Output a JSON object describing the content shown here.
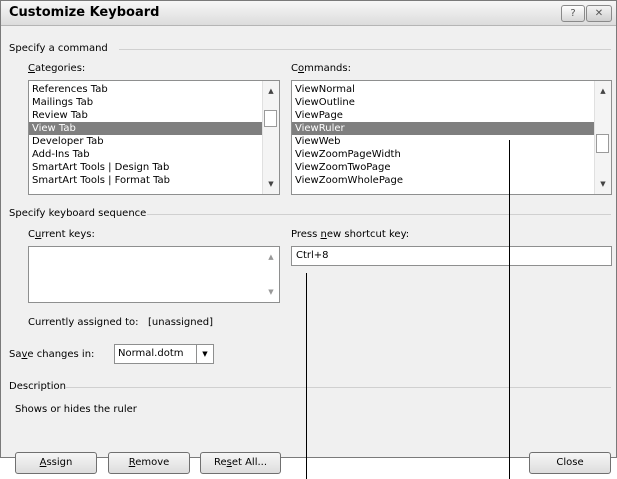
{
  "window": {
    "title": "Customize Keyboard",
    "help_glyph": "?",
    "close_glyph": "✕"
  },
  "command_group": {
    "label": "Specify a command",
    "categories": {
      "label_pre": "",
      "label_u": "C",
      "label_post": "ategories:",
      "items": [
        "References Tab",
        "Mailings Tab",
        "Review Tab",
        "View Tab",
        "Developer Tab",
        "Add-Ins Tab",
        "SmartArt Tools | Design Tab",
        "SmartArt Tools | Format Tab"
      ],
      "selected": "View Tab"
    },
    "commands": {
      "label_pre": "C",
      "label_u": "o",
      "label_post": "mmands:",
      "items": [
        "ViewNormal",
        "ViewOutline",
        "ViewPage",
        "ViewRuler",
        "ViewWeb",
        "ViewZoomPageWidth",
        "ViewZoomTwoPage",
        "ViewZoomWholePage"
      ],
      "selected": "ViewRuler"
    }
  },
  "keyboard_group": {
    "label": "Specify keyboard sequence",
    "current_keys": {
      "label_pre": "C",
      "label_u": "u",
      "label_post": "rrent keys:"
    },
    "new_key": {
      "label_pre": "Press ",
      "label_u": "n",
      "label_post": "ew shortcut key:",
      "value": "Ctrl+8"
    },
    "assigned_label": "Currently assigned to:",
    "assigned_value": "[unassigned]"
  },
  "save_changes": {
    "label_pre": "Sa",
    "label_u": "v",
    "label_post": "e changes in:",
    "value": "Normal.dotm"
  },
  "description": {
    "label": "Description",
    "text": "Shows or hides the ruler"
  },
  "buttons": {
    "assign": {
      "u": "A",
      "rest": "ssign"
    },
    "remove": {
      "u": "R",
      "rest": "emove"
    },
    "reset_all": {
      "pre": "Re",
      "u": "s",
      "rest": "et All..."
    },
    "close": "Close"
  }
}
